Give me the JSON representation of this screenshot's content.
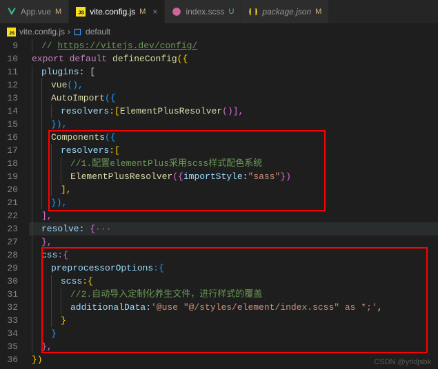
{
  "tabs": [
    {
      "icon": "vue",
      "label": "App.vue",
      "mod": "M",
      "active": false
    },
    {
      "icon": "js",
      "label": "vite.config.js",
      "mod": "M",
      "active": true
    },
    {
      "icon": "scss",
      "label": "index.scss",
      "mod": "U",
      "active": false
    },
    {
      "icon": "json",
      "label": "package.json",
      "mod": "M",
      "active": false
    }
  ],
  "breadcrumb": {
    "file": "vite.config.js",
    "symbol": "default"
  },
  "lines": {
    "n9": "9",
    "n10": "10",
    "n11": "11",
    "n12": "12",
    "n13": "13",
    "n14": "14",
    "n15": "15",
    "n16": "16",
    "n17": "17",
    "n18": "18",
    "n19": "19",
    "n20": "20",
    "n21": "21",
    "n22": "22",
    "n23": "23",
    "n27": "27",
    "n28": "28",
    "n29": "29",
    "n30": "30",
    "n31": "31",
    "n32": "32",
    "n33": "33",
    "n34": "34",
    "n35": "35",
    "n36": "36"
  },
  "code": {
    "l9_comment": "// ",
    "l9_link": "https://vitejs.dev/config/",
    "l10_export": "export",
    "l10_default": " default ",
    "l10_func": "defineConfig",
    "l10_br": "({",
    "l11_prop": "plugins",
    "l11_rest": ": [",
    "l12_func": "vue",
    "l12_rest": "(),",
    "l13_func": "AutoImport",
    "l13_rest": "({",
    "l14_prop": "resolvers",
    "l14_mid": ":[",
    "l14_func": "ElementPlusResolver",
    "l14_rest": "()],",
    "l15": "}),",
    "l16_func": "Components",
    "l16_rest": "({",
    "l17_prop": "resolvers",
    "l17_rest": ":[",
    "l18_comment": "//1.配置elementPlus采用scss样式配色系统",
    "l19_func": "ElementPlusResolver",
    "l19_open": "({",
    "l19_prop": "importStyle",
    "l19_colon": ":",
    "l19_str": "\"sass\"",
    "l19_close": "})",
    "l20": "],",
    "l21": "}),",
    "l22": "],",
    "l23_prop": "resolve",
    "l23_rest": ": ",
    "l23_brace": "{",
    "l23_dots": "···",
    "l27": "},",
    "l28_prop": "css",
    "l28_rest": ":{",
    "l29_prop": "preprocessorOptions",
    "l29_rest": ":{",
    "l30_prop": "scss",
    "l30_rest": ":{",
    "l31_comment": "//2.自动导入定制化养生文件，进行样式的覆盖",
    "l32_prop": "additionalData",
    "l32_colon": ":",
    "l32_str": "'@use \"@/styles/element/index.scss\" as *;'",
    "l32_end": ",",
    "l33": "}",
    "l34": "}",
    "l35": "},",
    "l36": "})"
  },
  "watermark": "CSDN @yrldjsbk"
}
